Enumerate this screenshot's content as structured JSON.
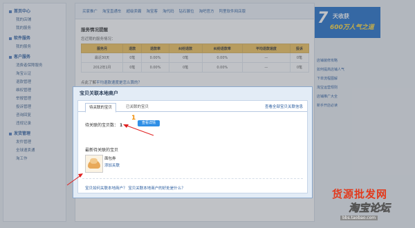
{
  "topnav": [
    "买家推广",
    "淘宝直通车",
    "超级卖霸",
    "淘宝客",
    "淘代码",
    "钻石展位",
    "淘吧官方",
    "阿里软件网店版"
  ],
  "sidebar": [
    {
      "title": "首页中心",
      "items": [
        "我的店铺",
        "我的服务"
      ]
    },
    {
      "title": "软件服务",
      "items": [
        "我的服务"
      ]
    },
    {
      "title": "客户服务",
      "items": [
        "消费者保障服务",
        "淘宝认证",
        "退款管理",
        "维权管理",
        "举报管理",
        "投诉管理",
        "咨询回复",
        "违规记录"
      ]
    },
    {
      "title": "发货管理",
      "items": [
        "发件管理",
        "全球速卖通",
        "淘工作"
      ]
    }
  ],
  "main": {
    "section_title": "服务情况提醒",
    "section_desc": "您近期的服务情况：",
    "table": {
      "headers": [
        "服务月",
        "退款",
        "退款率",
        "纠纷退款",
        "纠纷退款率",
        "平均退款速度",
        "投诉"
      ],
      "rows": [
        [
          "最近30天",
          "0笔",
          "0.00%",
          "0笔",
          "0.00%",
          "—",
          "0笔"
        ],
        [
          "2012年1月",
          "0笔",
          "0.00%",
          "0笔",
          "0.00%",
          "—",
          "0笔"
        ]
      ]
    },
    "note_prefix": "点此了解",
    "note_link": "平均退款速度是怎么算的？"
  },
  "ad": {
    "big": "7",
    "line1": "天收获",
    "line2": "600万人气之道"
  },
  "right_links": [
    "店铺装修攻略",
    "如何提高店铺人气",
    "下单流程图解",
    "淘宝运营规则",
    "店铺推广大全",
    "新手开店必读"
  ],
  "modal": {
    "title": "宝贝关联本地商户",
    "tab_active": "待关联的宝贝",
    "tab_inactive": "已关联的宝贝",
    "tab_link": "查看全部宝贝关联信息",
    "count_label": "待关联的宝贝数：",
    "count_value": "1",
    "detail_button": "查看详情",
    "recent_label": "最新待关联的宝贝",
    "item_name": "面包券",
    "item_link": "添加关联",
    "bottom_link": "宝贝如何关联本地商户？ 宝贝关联本地商户的好处是什么？"
  },
  "watermark": {
    "line1": "货源批发网",
    "line2": "淘宝论坛",
    "line3": "bbs.taobao.com"
  },
  "colors": {
    "accent": "#2f8fe6",
    "annotation": "#e02020",
    "table_header": "#f0c25a",
    "brand_blue": "#1f6fc9"
  }
}
